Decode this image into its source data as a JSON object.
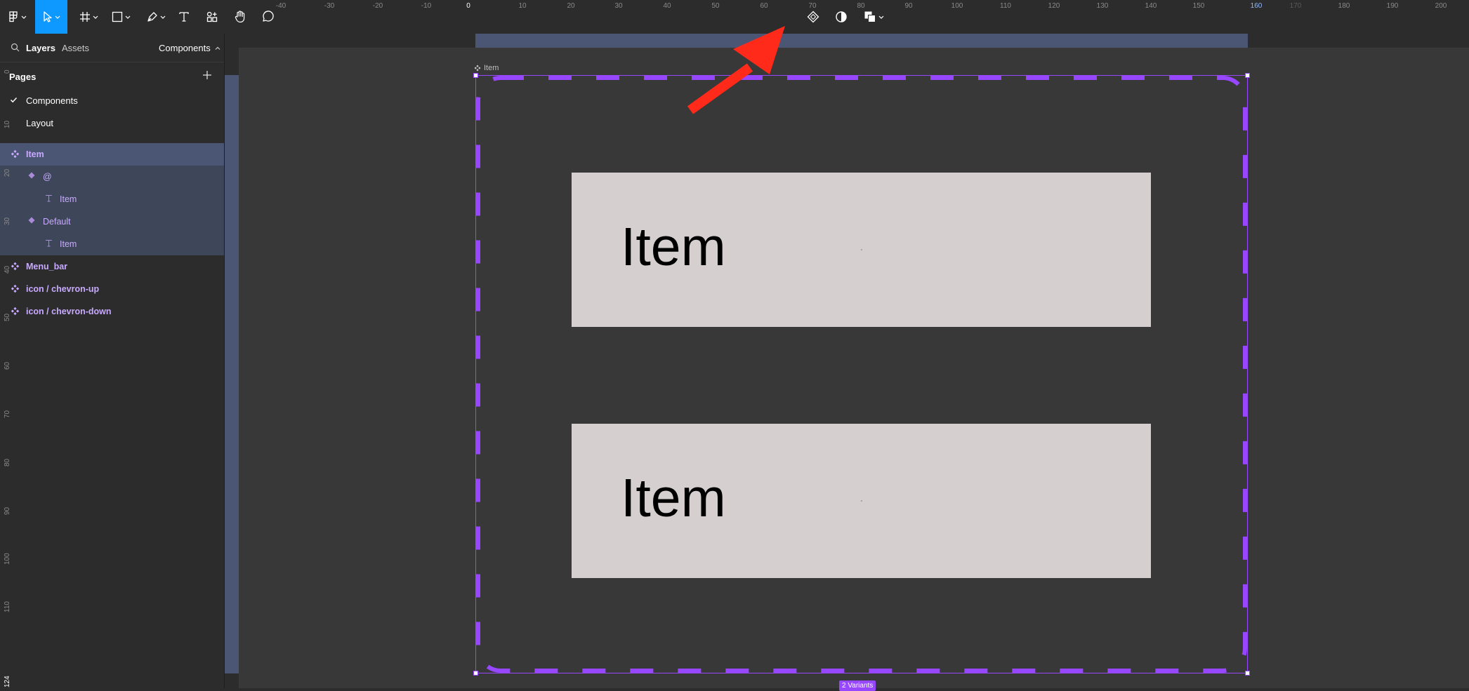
{
  "toolbar": {
    "tools": [
      "main-menu",
      "move",
      "frame",
      "shape",
      "pen",
      "text",
      "resources",
      "hand",
      "comment"
    ],
    "center_tools": [
      "create-component",
      "mask",
      "boolean-ops"
    ]
  },
  "left_panel": {
    "tabs": {
      "layers": "Layers",
      "assets": "Assets"
    },
    "page_switcher": "Components",
    "pages_title": "Pages",
    "pages": [
      {
        "label": "Components",
        "current": true
      },
      {
        "label": "Layout",
        "current": false
      }
    ],
    "layers": [
      {
        "label": "Item",
        "kind": "component-set",
        "indent": 0
      },
      {
        "label": "@",
        "kind": "variant",
        "indent": 1
      },
      {
        "label": "Item",
        "kind": "text",
        "indent": 2
      },
      {
        "label": "Default",
        "kind": "variant",
        "indent": 1
      },
      {
        "label": "Item",
        "kind": "text",
        "indent": 2
      },
      {
        "label": "Menu_bar",
        "kind": "component",
        "indent": 0
      },
      {
        "label": "icon / chevron-up",
        "kind": "component",
        "indent": 0
      },
      {
        "label": "icon / chevron-down",
        "kind": "component",
        "indent": 0
      }
    ]
  },
  "rulers": {
    "top": [
      "-40",
      "-30",
      "-20",
      "-10",
      "0",
      "10",
      "20",
      "30",
      "40",
      "50",
      "60",
      "70",
      "80",
      "90",
      "100",
      "110",
      "120",
      "130",
      "140",
      "150",
      "160",
      "170",
      "180",
      "190",
      "200"
    ],
    "left": [
      "0",
      "10",
      "20",
      "30",
      "40",
      "50",
      "60",
      "70",
      "80",
      "90",
      "100",
      "110",
      "124"
    ]
  },
  "canvas": {
    "frame_label": "Item",
    "variants": [
      {
        "text": "Item"
      },
      {
        "text": "Item"
      }
    ],
    "variants_badge": "2 Variants"
  },
  "colors": {
    "accent": "#0d99ff",
    "component": "#9747ff",
    "variant_fill": "#d6cfd0",
    "annotation": "#ff2a1a"
  }
}
